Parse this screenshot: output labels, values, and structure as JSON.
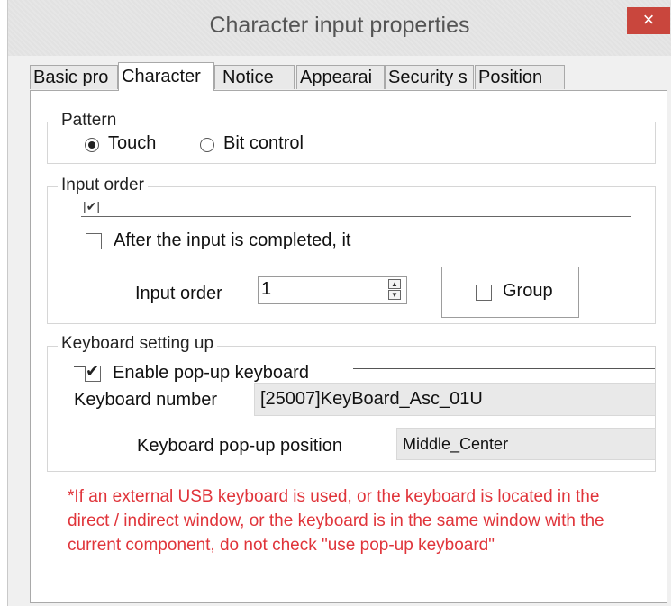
{
  "window": {
    "title": "Character input properties",
    "close_symbol": "×"
  },
  "tabs": [
    "Basic pro",
    "Character",
    "Notice",
    "Appearai",
    "Security s",
    "Position"
  ],
  "pattern": {
    "legend": "Pattern",
    "options": [
      "Touch",
      "Bit control"
    ],
    "selected": "Touch"
  },
  "input_order_group": {
    "legend": "Input order",
    "after_input_label": "After the input is completed, it",
    "input_order_label": "Input order",
    "input_order_value": "1",
    "group_label": "Group"
  },
  "keyboard": {
    "legend": "Keyboard setting up",
    "enable_label": "Enable pop-up keyboard",
    "enable_checked": true,
    "number_label": "Keyboard number",
    "number_value": "[25007]KeyBoard_Asc_01U",
    "position_label": "Keyboard pop-up position",
    "position_value": "Middle_Center"
  },
  "note": "*If an external USB keyboard is used, or the keyboard is located in the direct / indirect window, or the keyboard is in the same window with the current component, do not check \"use pop-up keyboard\""
}
